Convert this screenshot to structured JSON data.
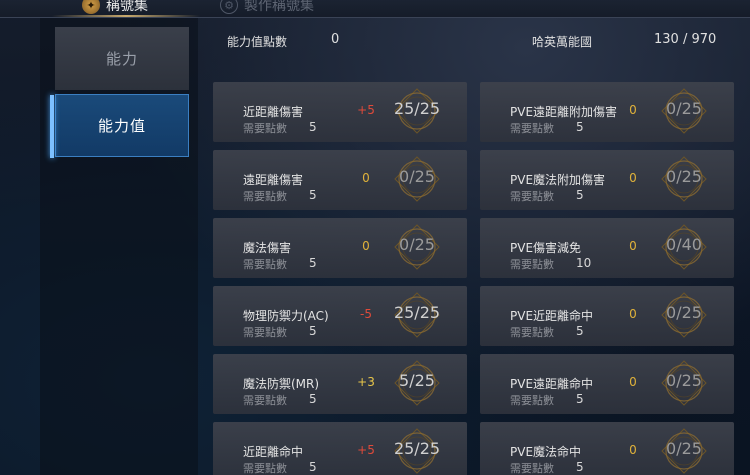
{
  "tabs": [
    {
      "label": "稱號集",
      "icon": "emblem-icon"
    },
    {
      "label": "製作稱號集",
      "icon": "gear-icon"
    }
  ],
  "sidebar": {
    "items": [
      {
        "label": "能力"
      },
      {
        "label": "能力值"
      }
    ]
  },
  "header": {
    "points_label": "能力值點數",
    "points_value": "0",
    "hall_label": "哈英萬能國",
    "hall_value": "130 / 970"
  },
  "colors": {
    "accent_blue": "#3b7fc2",
    "bonus_positive": "#e8c64a",
    "bonus_negative": "#e04a3a",
    "ring_gold": "#8a6a32"
  },
  "left_stats": [
    {
      "name": "近距離傷害",
      "bonus": "+5",
      "bonus_type": "red",
      "count": "25/25",
      "req_label": "需要點數",
      "req_value": "5"
    },
    {
      "name": "遠距離傷害",
      "bonus": "0",
      "bonus_type": "zero",
      "count": "0/25",
      "req_label": "需要點數",
      "req_value": "5"
    },
    {
      "name": "魔法傷害",
      "bonus": "0",
      "bonus_type": "zero",
      "count": "0/25",
      "req_label": "需要點數",
      "req_value": "5"
    },
    {
      "name": "物理防禦力(AC)",
      "bonus": "-5",
      "bonus_type": "red",
      "count": "25/25",
      "req_label": "需要點數",
      "req_value": "5"
    },
    {
      "name": "魔法防禦(MR)",
      "bonus": "+3",
      "bonus_type": "pos",
      "count": "5/25",
      "req_label": "需要點數",
      "req_value": "5"
    },
    {
      "name": "近距離命中",
      "bonus": "+5",
      "bonus_type": "red",
      "count": "25/25",
      "req_label": "需要點數",
      "req_value": "5"
    }
  ],
  "right_stats": [
    {
      "name": "PVE遠距離附加傷害",
      "bonus": "0",
      "bonus_type": "zero",
      "count": "0/25",
      "req_label": "需要點數",
      "req_value": "5"
    },
    {
      "name": "PVE魔法附加傷害",
      "bonus": "0",
      "bonus_type": "zero",
      "count": "0/25",
      "req_label": "需要點數",
      "req_value": "5"
    },
    {
      "name": "PVE傷害減免",
      "bonus": "0",
      "bonus_type": "zero",
      "count": "0/40",
      "req_label": "需要點數",
      "req_value": "10"
    },
    {
      "name": "PVE近距離命中",
      "bonus": "0",
      "bonus_type": "zero",
      "count": "0/25",
      "req_label": "需要點數",
      "req_value": "5"
    },
    {
      "name": "PVE遠距離命中",
      "bonus": "0",
      "bonus_type": "zero",
      "count": "0/25",
      "req_label": "需要點數",
      "req_value": "5"
    },
    {
      "name": "PVE魔法命中",
      "bonus": "0",
      "bonus_type": "zero",
      "count": "0/25",
      "req_label": "需要點數",
      "req_value": "5"
    }
  ]
}
